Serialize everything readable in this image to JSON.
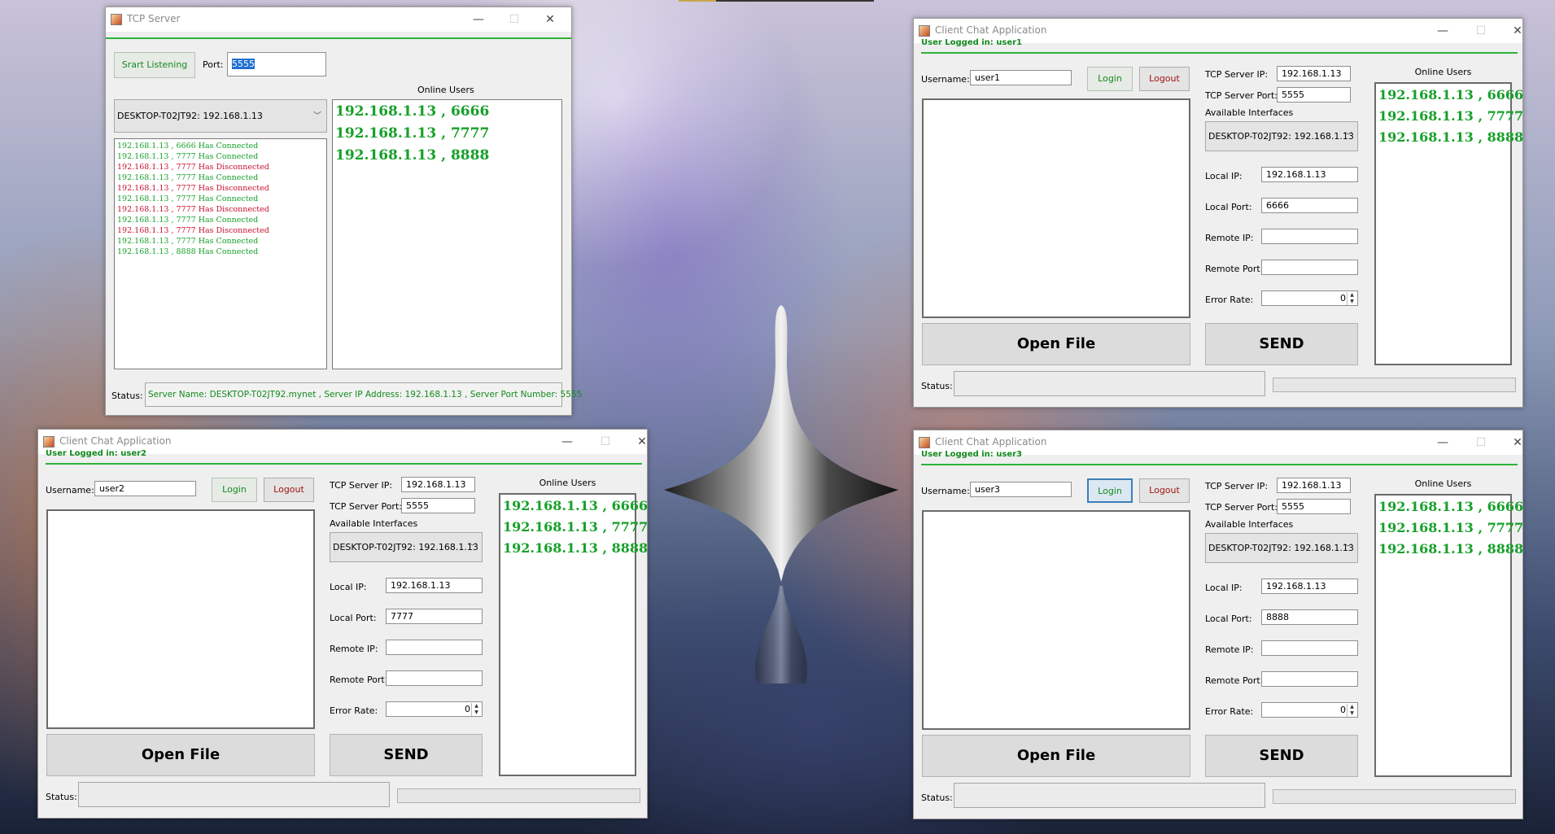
{
  "desktop": {
    "spintop_icon": "spinning-top-image"
  },
  "server": {
    "title": "TCP Server",
    "start_button": "Srart Listening",
    "port_label": "Port:",
    "port_value": "5555",
    "online_users_label": "Online Users",
    "interface": "DESKTOP-T02JT92: 192.168.1.13",
    "log": [
      {
        "text": "192.168.1.13 , 6666 Has Connected",
        "kind": "ok"
      },
      {
        "text": "192.168.1.13 , 7777 Has Connected",
        "kind": "ok"
      },
      {
        "text": "192.168.1.13 , 7777 Has Disconnected",
        "kind": "bad"
      },
      {
        "text": "192.168.1.13 , 7777 Has Connected",
        "kind": "ok"
      },
      {
        "text": "192.168.1.13 , 7777 Has Disconnected",
        "kind": "bad"
      },
      {
        "text": "192.168.1.13 , 7777 Has Connected",
        "kind": "ok"
      },
      {
        "text": "192.168.1.13 , 7777 Has Disconnected",
        "kind": "bad"
      },
      {
        "text": "192.168.1.13 , 7777 Has Connected",
        "kind": "ok"
      },
      {
        "text": "192.168.1.13 , 7777 Has Disconnected",
        "kind": "bad"
      },
      {
        "text": "192.168.1.13 , 7777 Has Connected",
        "kind": "ok"
      },
      {
        "text": "192.168.1.13 , 8888 Has Connected",
        "kind": "ok"
      }
    ],
    "online_users": [
      "192.168.1.13 , 6666",
      "192.168.1.13 , 7777",
      "192.168.1.13 , 8888"
    ],
    "status_label": "Status:",
    "status_text": "Server Name: DESKTOP-T02JT92.mynet , Server IP Address: 192.168.1.13 , Server Port Number: 5555"
  },
  "common": {
    "client_title": "Client Chat Application",
    "username_label": "Username:",
    "login": "Login",
    "logout": "Logout",
    "tcp_ip_label": "TCP Server IP:",
    "tcp_port_label": "TCP Server Port:",
    "interfaces_label": "Available Interfaces",
    "local_ip_label": "Local IP:",
    "local_port_label": "Local Port:",
    "remote_ip_label": "Remote IP:",
    "remote_port_label": "Remote Port:",
    "error_rate_label": "Error Rate:",
    "open_file": "Open File",
    "send": "SEND",
    "online_users_label": "Online Users",
    "status_label": "Status:",
    "minimize": "—",
    "maximize": "☐",
    "close": "✕"
  },
  "client1": {
    "logged_in": "User Logged in: user1",
    "username": "user1",
    "tcp_ip": "192.168.1.13",
    "tcp_port": "5555",
    "interface": "DESKTOP-T02JT92: 192.168.1.13",
    "local_ip": "192.168.1.13",
    "local_port": "6666",
    "remote_ip": "",
    "remote_port": "",
    "error_rate": "0",
    "online_users": [
      "192.168.1.13 , 6666",
      "192.168.1.13 , 7777",
      "192.168.1.13 , 8888"
    ]
  },
  "client2": {
    "logged_in": "User Logged in: user2",
    "username": "user2",
    "tcp_ip": "192.168.1.13",
    "tcp_port": "5555",
    "interface": "DESKTOP-T02JT92: 192.168.1.13",
    "local_ip": "192.168.1.13",
    "local_port": "7777",
    "remote_ip": "",
    "remote_port": "",
    "error_rate": "0",
    "online_users": [
      "192.168.1.13 , 6666",
      "192.168.1.13 , 7777",
      "192.168.1.13 , 8888"
    ]
  },
  "client3": {
    "logged_in": "User Logged in: user3",
    "username": "user3",
    "tcp_ip": "192.168.1.13",
    "tcp_port": "5555",
    "interface": "DESKTOP-T02JT92: 192.168.1.13",
    "local_ip": "192.168.1.13",
    "local_port": "8888",
    "remote_ip": "",
    "remote_port": "",
    "error_rate": "0",
    "online_users": [
      "192.168.1.13 , 6666",
      "192.168.1.13 , 7777",
      "192.168.1.13 , 8888"
    ]
  }
}
